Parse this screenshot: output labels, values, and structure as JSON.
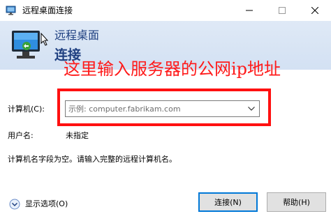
{
  "window": {
    "title": "远程桌面连接",
    "minimize_glyph": "—",
    "maximize_glyph": "☐",
    "close_glyph": "✕"
  },
  "header": {
    "subtitle": "远程桌面",
    "title": "连接"
  },
  "annotation": {
    "text": "这里输入服务器的公网ip地址",
    "color": "#ff1a1a"
  },
  "form": {
    "computer_label": "计算机(C):",
    "computer_placeholder": "示例: computer.fabrikam.com",
    "computer_value": "",
    "user_label": "用户名:",
    "user_value": "未指定",
    "info": "计算机名字段为空。请输入完整的远程计算机名。"
  },
  "footer": {
    "show_options_label": "显示选项(O)",
    "connect_label": "连接(N)",
    "help_label": "帮助(H)"
  },
  "colors": {
    "header_bg": "#dde8f5",
    "header_text": "#1e3f80",
    "accent": "#0078d7"
  }
}
